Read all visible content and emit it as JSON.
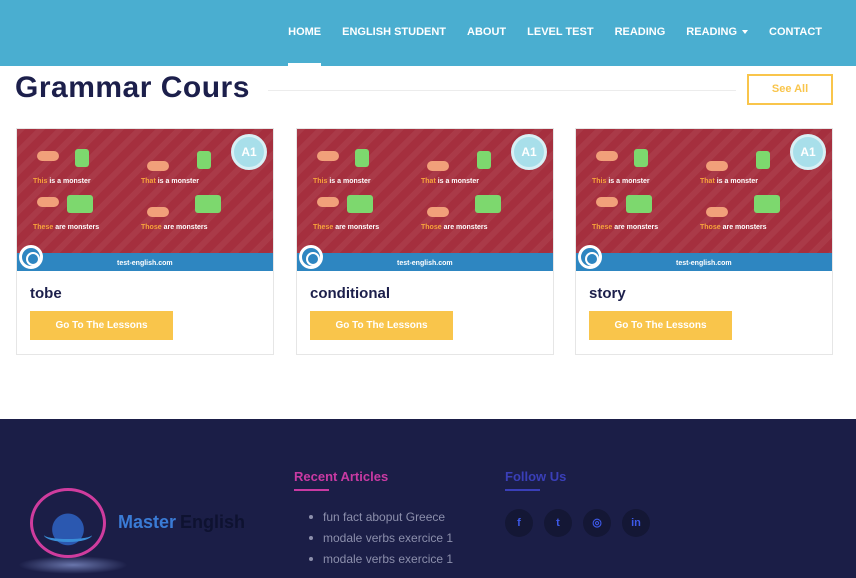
{
  "nav": {
    "items": [
      {
        "label": "HOME"
      },
      {
        "label": "ENGLISH STUDENT"
      },
      {
        "label": "ABOUT"
      },
      {
        "label": "LEVEL TEST"
      },
      {
        "label": "READING"
      },
      {
        "label": "READING"
      },
      {
        "label": "CONTACT"
      }
    ]
  },
  "section": {
    "title": "Grammar Cours",
    "see_all_label": "See All"
  },
  "cards": [
    {
      "title": "tobe",
      "button_label": "Go To The Lessons"
    },
    {
      "title": "conditional",
      "button_label": "Go To The Lessons"
    },
    {
      "title": "story",
      "button_label": "Go To The Lessons"
    }
  ],
  "card_image": {
    "badge": "A1",
    "url": "test-english.com",
    "row1_left_keyword": "This",
    "row1_left_rest": "is a monster",
    "row1_right_keyword": "That",
    "row1_right_rest": "is a monster",
    "row2_left_keyword": "These",
    "row2_left_rest": "are monsters",
    "row2_right_keyword": "Those",
    "row2_right_rest": "are monsters"
  },
  "footer": {
    "logo_word1": "Master",
    "logo_word2": "English",
    "recent_articles_heading": "Recent Articles",
    "articles": [
      "fun fact aboput Greece",
      "modale verbs exercice 1",
      "modale verbs exercice 1"
    ],
    "follow_heading": "Follow Us",
    "social": [
      {
        "icon": "facebook-icon",
        "glyph": "f"
      },
      {
        "icon": "twitter-icon",
        "glyph": "t"
      },
      {
        "icon": "instagram-icon",
        "glyph": "◎"
      },
      {
        "icon": "linkedin-icon",
        "glyph": "in"
      }
    ]
  },
  "colors": {
    "nav_bg": "#4aaed0",
    "accent_yellow": "#f9c54b",
    "title_navy": "#1c1f4b",
    "footer_bg": "#1b1e47",
    "recent_heading": "#c93aa3",
    "follow_heading": "#3a3fb8"
  }
}
